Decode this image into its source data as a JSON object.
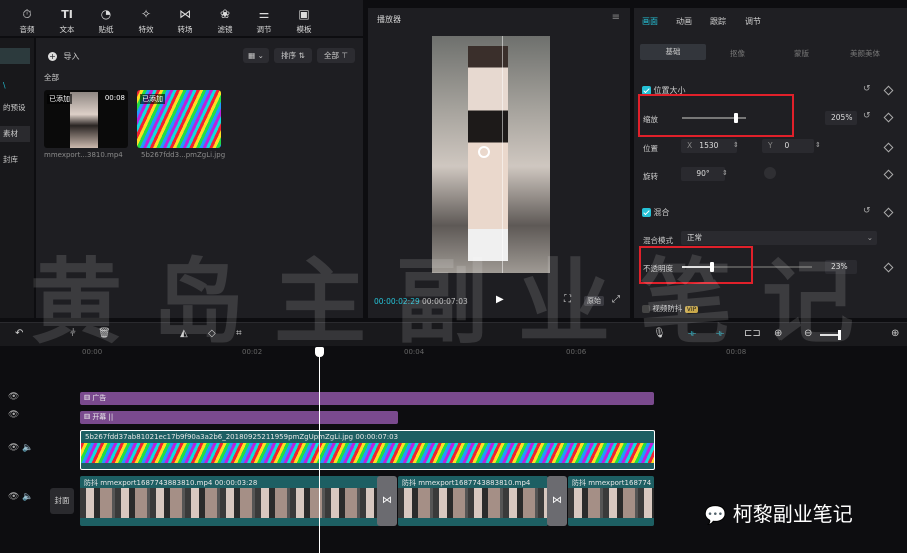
{
  "toolbar": {
    "items": [
      {
        "label": "音频",
        "icon": "clock-icon",
        "glyph": "⏱"
      },
      {
        "label": "文本",
        "icon": "text-icon",
        "glyph": "TI"
      },
      {
        "label": "贴纸",
        "icon": "sticker-icon",
        "glyph": "◔"
      },
      {
        "label": "特效",
        "icon": "sparkle-icon",
        "glyph": "✧"
      },
      {
        "label": "转场",
        "icon": "transition-icon",
        "glyph": "⋈"
      },
      {
        "label": "滤镜",
        "icon": "filter-icon",
        "glyph": "❀"
      },
      {
        "label": "调节",
        "icon": "adjust-icon",
        "glyph": "⚌"
      },
      {
        "label": "模板",
        "icon": "template-icon",
        "glyph": "▣"
      }
    ]
  },
  "sidebar": {
    "items": [
      "",
      "",
      "的预设",
      "素材",
      "封库"
    ]
  },
  "media": {
    "import_label": "导入",
    "sort_label": "排序",
    "all_filter": "全部",
    "section_label": "全部",
    "items": [
      {
        "badge": "已添加",
        "duration": "00:08",
        "name": "mmexport...3810.mp4"
      },
      {
        "badge": "已添加",
        "duration": "",
        "name": "5b267fdd3...pmZgLi.jpg"
      }
    ]
  },
  "player": {
    "title": "播放器",
    "current_time": "00:00:02:29",
    "total_time": "00:00:07:03",
    "original_label": "原始"
  },
  "inspector": {
    "tabs": [
      "画面",
      "动画",
      "跟踪",
      "调节"
    ],
    "subtabs": [
      "基础",
      "抠像",
      "蒙版",
      "美颜美体"
    ],
    "position_section": "位置大小",
    "scale_label": "缩放",
    "scale_value": "205%",
    "scale_level": 0.85,
    "position_label": "位置",
    "x_label": "X",
    "x_value": "1530",
    "y_label": "Y",
    "y_value": "0",
    "rotate_label": "旋转",
    "rotate_value": "90°",
    "blend_section": "混合",
    "blend_mode_label": "混合模式",
    "blend_mode_value": "正常",
    "opacity_label": "不透明度",
    "opacity_value": "23%",
    "opacity_level": 0.23,
    "stabilize_label": "视频防抖",
    "vip_badge": "VIP"
  },
  "timeline": {
    "ticks": [
      "00:00",
      "00:02",
      "00:04",
      "00:06",
      "00:08"
    ],
    "tracks": {
      "ad_clip": "广告",
      "opening_clip": "开幕 ||",
      "image_clip": "5b267fdd37ab81021ec17b9f90a3a2b6_20180925211959pmZgUpmZgLi.jpg   00:00:07:03",
      "video_clip_1": "防抖   mmexport1687743883810.mp4   00:00:03:28",
      "video_clip_2": "防抖   mmexport1687743883810.mp4",
      "video_clip_3": "防抖   mmexport168774",
      "cover_label": "封面"
    }
  },
  "watermark": "黄岛主副业笔记",
  "wechat_label": "柯黎副业笔记",
  "colors": {
    "accent": "#25c1d6",
    "highlight_box": "#e0202a",
    "clip_purple": "#7a4a8e",
    "clip_teal": "#1d5f63"
  }
}
